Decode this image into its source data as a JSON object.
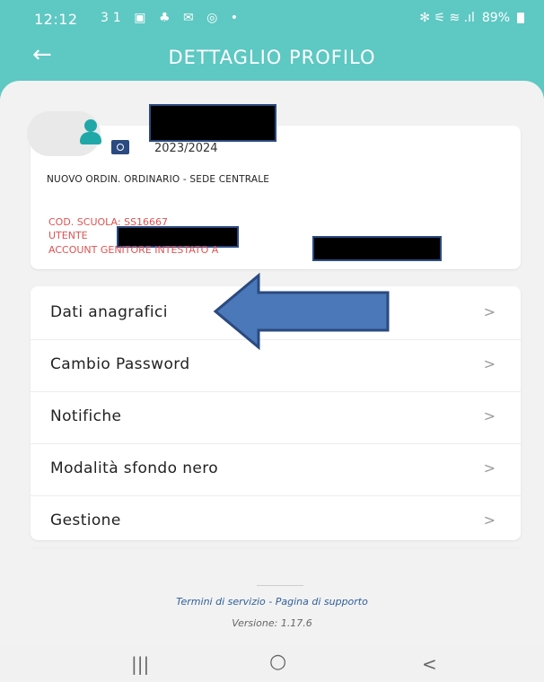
{
  "status_bar": {
    "time": "12:12",
    "left_icons": "31 ▣ ♣ ✉ ◎ •",
    "right_icons": "✻ ⚟ ≋ .ıl",
    "battery": "89%"
  },
  "header": {
    "title": "DETTAGLIO PROFILO",
    "bg_color": "#5ec8c3"
  },
  "profile": {
    "school_year": "2023/2024",
    "school_name": "NUOVO ORDIN. ORDINARIO - SEDE CENTRALE",
    "school_code": "COD. SCUOLA: SS16667",
    "user_label": "UTENTE",
    "account_label": "ACCOUNT GENITORE INTESTATO A",
    "info_color": "#e05252"
  },
  "menu": {
    "items": [
      {
        "label": "Dati anagrafici",
        "chevron": ">"
      },
      {
        "label": "Cambio Password",
        "chevron": ">"
      },
      {
        "label": "Notifiche",
        "chevron": ">"
      },
      {
        "label": "Modalità sfondo nero",
        "chevron": ">"
      },
      {
        "label": "Gestione",
        "chevron": ">"
      }
    ]
  },
  "footer": {
    "links": "Termini di servizio - Pagina di supporto",
    "version": "Versione: 1.17.6"
  },
  "nav_bar": {
    "recent": "|||",
    "home": "○",
    "back": "<"
  },
  "annotation": {
    "arrow_color": "#4a78b8",
    "arrow_outline": "#2a4a80"
  }
}
